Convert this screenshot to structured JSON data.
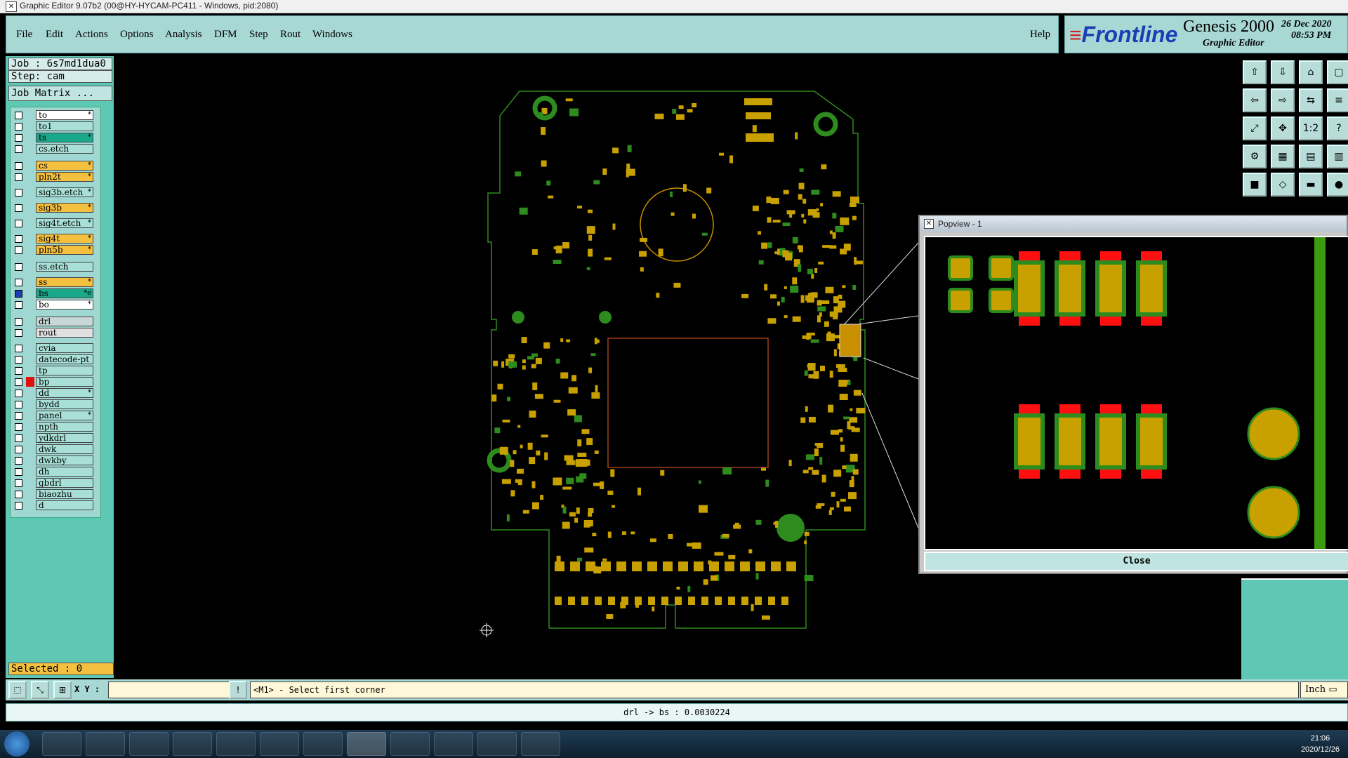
{
  "window": {
    "title": "Graphic Editor 9.07b2 (00@HY-HYCAM-PC411 - Windows, pid:2080)"
  },
  "menu": [
    "File",
    "Edit",
    "Actions",
    "Options",
    "Analysis",
    "DFM",
    "Step",
    "Rout",
    "Windows"
  ],
  "help": "Help",
  "brand": {
    "logo": "Frontline",
    "product": "Genesis 2000",
    "subtitle": "Graphic Editor",
    "date": "26 Dec 2020",
    "time": "08:53 PM"
  },
  "job": {
    "job": "Job : 6s7md1dua0",
    "step": "Step: cam",
    "matrix": "Job Matrix ..."
  },
  "layers": [
    {
      "name": "to",
      "color": "#ffffff",
      "mark": "*"
    },
    {
      "name": "to1",
      "color": "#a8e0d8",
      "mark": ""
    },
    {
      "name": "ts",
      "color": "#1aa88a",
      "mark": "*"
    },
    {
      "name": "cs.etch",
      "color": "#a8e0d8",
      "mark": ""
    },
    {
      "name": "cs",
      "color": "#f4c040",
      "mark": "*"
    },
    {
      "name": "pln2t",
      "color": "#f4c040",
      "mark": "*"
    },
    {
      "name": "sig3b.etch",
      "color": "#a8e0d8",
      "mark": "*"
    },
    {
      "name": "sig3b",
      "color": "#f4c040",
      "mark": "*"
    },
    {
      "name": "sig4t.etch",
      "color": "#a8e0d8",
      "mark": "*"
    },
    {
      "name": "sig4t",
      "color": "#f4c040",
      "mark": "*"
    },
    {
      "name": "pln5b",
      "color": "#f4c040",
      "mark": "*"
    },
    {
      "name": "ss.etch",
      "color": "#a8e0d8",
      "mark": ""
    },
    {
      "name": "ss",
      "color": "#f4c040",
      "mark": "*"
    },
    {
      "name": "bs",
      "color": "#1aa88a",
      "mark": "*e"
    },
    {
      "name": "bo",
      "color": "#ffffff",
      "mark": "*"
    },
    {
      "name": "drl",
      "color": "#c8d8d8",
      "mark": ""
    },
    {
      "name": "rout",
      "color": "#e0e0e0",
      "mark": ""
    },
    {
      "name": "cvia",
      "color": "#a8e0d8",
      "mark": ""
    },
    {
      "name": "datecode-pt",
      "color": "#a8e0d8",
      "mark": ""
    },
    {
      "name": "tp",
      "color": "#a8e0d8",
      "mark": ""
    },
    {
      "name": "bp",
      "color": "#a8e0d8",
      "mark": ""
    },
    {
      "name": "dd",
      "color": "#a8e0d8",
      "mark": "*"
    },
    {
      "name": "bydd",
      "color": "#a8e0d8",
      "mark": ""
    },
    {
      "name": "panel",
      "color": "#a8e0d8",
      "mark": "*"
    },
    {
      "name": "npth",
      "color": "#a8e0d8",
      "mark": ""
    },
    {
      "name": "ydkdrl",
      "color": "#a8e0d8",
      "mark": ""
    },
    {
      "name": "dwk",
      "color": "#a8e0d8",
      "mark": ""
    },
    {
      "name": "dwkby",
      "color": "#a8e0d8",
      "mark": ""
    },
    {
      "name": "dh",
      "color": "#a8e0d8",
      "mark": ""
    },
    {
      "name": "gbdrl",
      "color": "#a8e0d8",
      "mark": ""
    },
    {
      "name": "biaozhu",
      "color": "#a8e0d8",
      "mark": ""
    },
    {
      "name": "d",
      "color": "#a8e0d8",
      "mark": ""
    }
  ],
  "selected": "Selected : 0",
  "popview": {
    "title": "Popview - 1",
    "close": "Close"
  },
  "cmd": {
    "xy_label": "X Y :",
    "xy_value": "",
    "bang": "!",
    "message": "<M1> - Select first corner",
    "unit": "Inch"
  },
  "status": "drl -> bs : 0.0030224",
  "clock": {
    "time": "21:06",
    "date": "2020/12/26"
  },
  "colors": {
    "board_green": "#2e8b1e",
    "pad_gold": "#c8a000",
    "drill_red": "#ff1010",
    "panel_teal": "#5fc8b4"
  }
}
